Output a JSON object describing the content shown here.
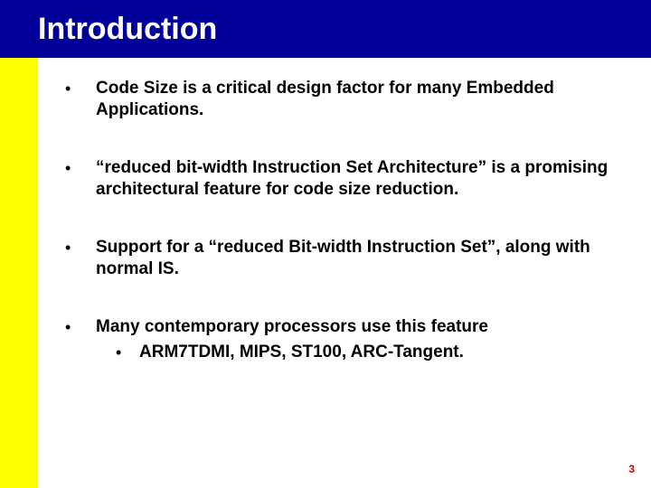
{
  "title": "Introduction",
  "bullets": [
    {
      "text": "Code Size is a critical design factor for many Embedded Applications."
    },
    {
      "text": "“reduced bit-width Instruction Set Architecture” is a promising architectural feature for code size reduction."
    },
    {
      "text": "Support for a “reduced Bit-width Instruction Set”, along with normal IS."
    },
    {
      "text": "Many contemporary processors use this feature",
      "sub": [
        {
          "text": "ARM7TDMI, MIPS, ST100, ARC-Tangent."
        }
      ]
    }
  ],
  "page_number": "3",
  "bullet_glyph": "•",
  "colors": {
    "title_bg": "#000099",
    "sidebar": "#ffff00",
    "pagenum": "#cc0000"
  }
}
